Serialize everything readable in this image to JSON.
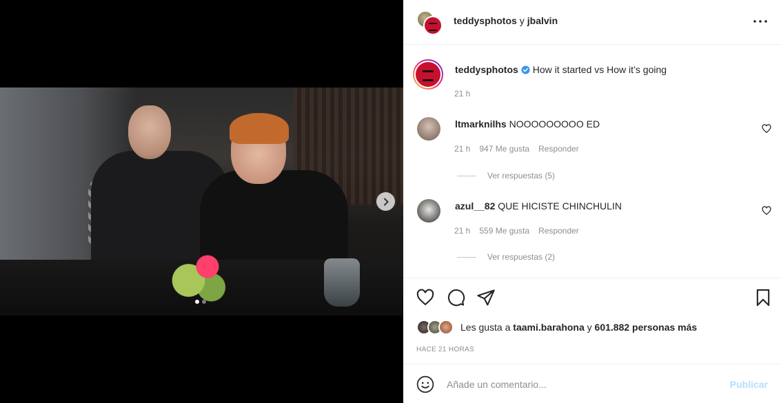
{
  "header": {
    "user1": "teddysphotos",
    "conjunction": "y",
    "user2": "jbalvin",
    "more_icon": "more-horizontal-icon"
  },
  "caption": {
    "username": "teddysphotos",
    "text": "How it started vs How it’s going",
    "time": "21 h",
    "verified_icon": "verified-badge-icon"
  },
  "comments": [
    {
      "username": "ltmarknilhs",
      "text": "NOOOOOOOOO ED",
      "time": "21 h",
      "likes": "947 Me gusta",
      "reply_label": "Responder",
      "view_replies": "Ver respuestas (5)"
    },
    {
      "username": "azul__82",
      "text": "QUE HICISTE CHINCHULIN",
      "time": "21 h",
      "likes": "559 Me gusta",
      "reply_label": "Responder",
      "view_replies": "Ver respuestas (2)"
    }
  ],
  "likes": {
    "prefix": "Les gusta a",
    "user": "taami.barahona",
    "middle": "y",
    "count": "601.882 personas más"
  },
  "posted_ago": "HACE 21 HORAS",
  "add_comment": {
    "placeholder": "Añade un comentario...",
    "publish_label": "Publicar"
  },
  "carousel": {
    "total_slides": 2,
    "current_slide": 1
  },
  "colors": {
    "verified": "#3897f0",
    "publish_disabled": "#b2dffc",
    "secondary_text": "#8e8e8e"
  }
}
